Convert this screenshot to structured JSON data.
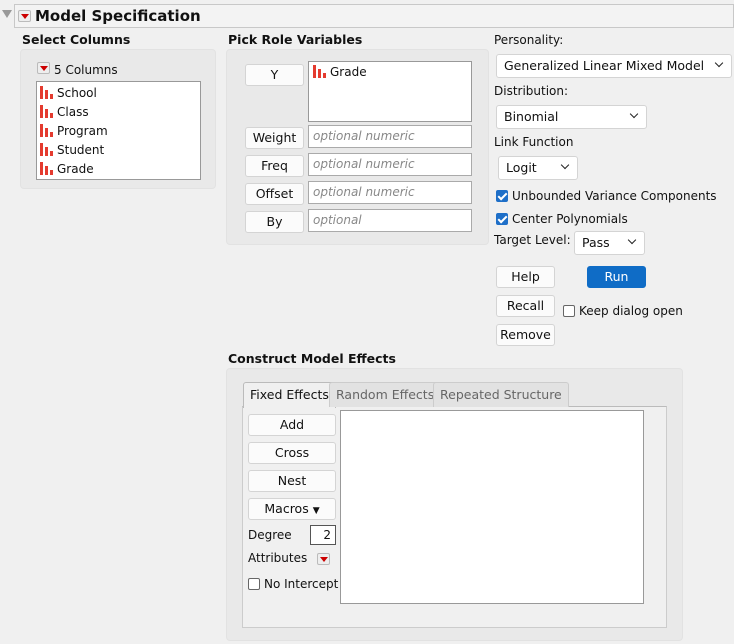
{
  "header": {
    "title": "Model Specification"
  },
  "select_columns": {
    "label": "Select Columns",
    "count": "5 Columns",
    "columns": [
      "School",
      "Class",
      "Program",
      "Student",
      "Grade"
    ]
  },
  "roles": {
    "label": "Pick Role Variables",
    "y_button": "Y",
    "y_value": "Grade",
    "weight": "Weight",
    "weight_ph": "optional numeric",
    "freq": "Freq",
    "freq_ph": "optional numeric",
    "offset": "Offset",
    "offset_ph": "optional numeric",
    "by": "By",
    "by_ph": "optional"
  },
  "options": {
    "personality_label": "Personality:",
    "personality": "Generalized Linear Mixed Model",
    "distribution_label": "Distribution:",
    "distribution": "Binomial",
    "link_label": "Link Function",
    "link": "Logit",
    "unbounded": "Unbounded Variance Components",
    "center": "Center Polynomials",
    "target_label": "Target Level:",
    "target": "Pass",
    "help": "Help",
    "run": "Run",
    "recall": "Recall",
    "keep_open": "Keep dialog open",
    "remove": "Remove"
  },
  "effects": {
    "label": "Construct Model Effects",
    "tabs": [
      "Fixed Effects",
      "Random Effects",
      "Repeated Structure"
    ],
    "add": "Add",
    "cross": "Cross",
    "nest": "Nest",
    "macros": "Macros",
    "degree_label": "Degree",
    "degree": "2",
    "attributes": "Attributes",
    "no_intercept": "No Intercept"
  }
}
